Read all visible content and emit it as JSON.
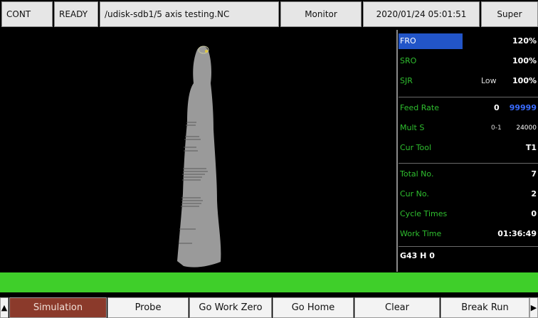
{
  "status": {
    "mode": "CONT",
    "state": "READY",
    "file": "/udisk-sdb1/5 axis testing.NC",
    "view": "Monitor",
    "datetime": "2020/01/24 05:01:51",
    "user": "Super"
  },
  "panel": {
    "fro": {
      "label": "FRO",
      "value": "120%"
    },
    "sro": {
      "label": "SRO",
      "value": "100%"
    },
    "sjr": {
      "label": "SJR",
      "mid": "Low",
      "value": "100%"
    },
    "feed_rate": {
      "label": "Feed Rate",
      "mid": "0",
      "value": "99999"
    },
    "mult_s": {
      "label": "Mult S",
      "mid": "0-1",
      "value": "24000"
    },
    "cur_tool": {
      "label": "Cur Tool",
      "value": "T1"
    },
    "total_no": {
      "label": "Total No.",
      "value": "7"
    },
    "cur_no": {
      "label": "Cur No.",
      "value": "2"
    },
    "cycle_times": {
      "label": "Cycle Times",
      "value": "0"
    },
    "work_time": {
      "label": "Work Time",
      "value": "01:36:49"
    },
    "gcode": "G43 H 0"
  },
  "softkeys": {
    "left_arrow": "▲",
    "right_arrow": "▶",
    "items": [
      "Simulation",
      "Probe",
      "Go Work Zero",
      "Go Home",
      "Clear",
      "Break Run"
    ],
    "active": "Simulation"
  },
  "colors": {
    "label_green": "#2fbf2f",
    "fro_highlight": "#2255c8",
    "status_green_bar": "#3fcf2a",
    "active_key": "#8b3a2b",
    "feed_value_blue": "#3a6cff"
  }
}
